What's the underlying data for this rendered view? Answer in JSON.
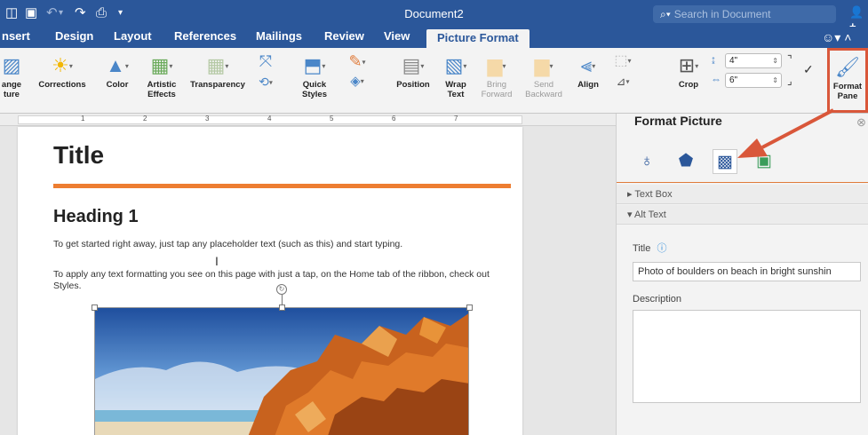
{
  "window": {
    "title": "Document2"
  },
  "search": {
    "placeholder": "Search in Document"
  },
  "tabs": [
    {
      "label": "nsert"
    },
    {
      "label": "Design"
    },
    {
      "label": "Layout"
    },
    {
      "label": "References"
    },
    {
      "label": "Mailings"
    },
    {
      "label": "Review"
    },
    {
      "label": "View"
    },
    {
      "label": "Picture Format"
    }
  ],
  "ribbon": {
    "change_picture_1": "ange",
    "change_picture_2": "ture",
    "corrections": "Corrections",
    "color": "Color",
    "artistic_effects_1": "Artistic",
    "artistic_effects_2": "Effects",
    "transparency": "Transparency",
    "quick_styles_1": "Quick",
    "quick_styles_2": "Styles",
    "position": "Position",
    "wrap_text_1": "Wrap",
    "wrap_text_2": "Text",
    "bring_forward_1": "Bring",
    "bring_forward_2": "Forward",
    "send_backward_1": "Send",
    "send_backward_2": "Backward",
    "align": "Align",
    "crop": "Crop",
    "height_value": "4\"",
    "width_value": "6\"",
    "format_pane_1": "Format",
    "format_pane_2": "Pane"
  },
  "ruler": {
    "numbers": [
      "1",
      "2",
      "3",
      "4",
      "5",
      "6",
      "7"
    ]
  },
  "document": {
    "title": "Title",
    "heading": "Heading 1",
    "para1": "To get started right away, just tap any placeholder text (such as this) and start typing.",
    "para2": "To apply any text formatting you see on this page with just a tap, on the Home tab of the ribbon, check out Styles."
  },
  "pane": {
    "title": "Format Picture",
    "section_text_box": "Text Box",
    "section_alt_text": "Alt Text",
    "alt_title_label": "Title",
    "alt_title_value": "Photo of boulders on beach in bright sunshin",
    "description_label": "Description"
  },
  "colors": {
    "brand": "#2b579a",
    "accent": "#ed7d31",
    "callout": "#d9573a"
  }
}
